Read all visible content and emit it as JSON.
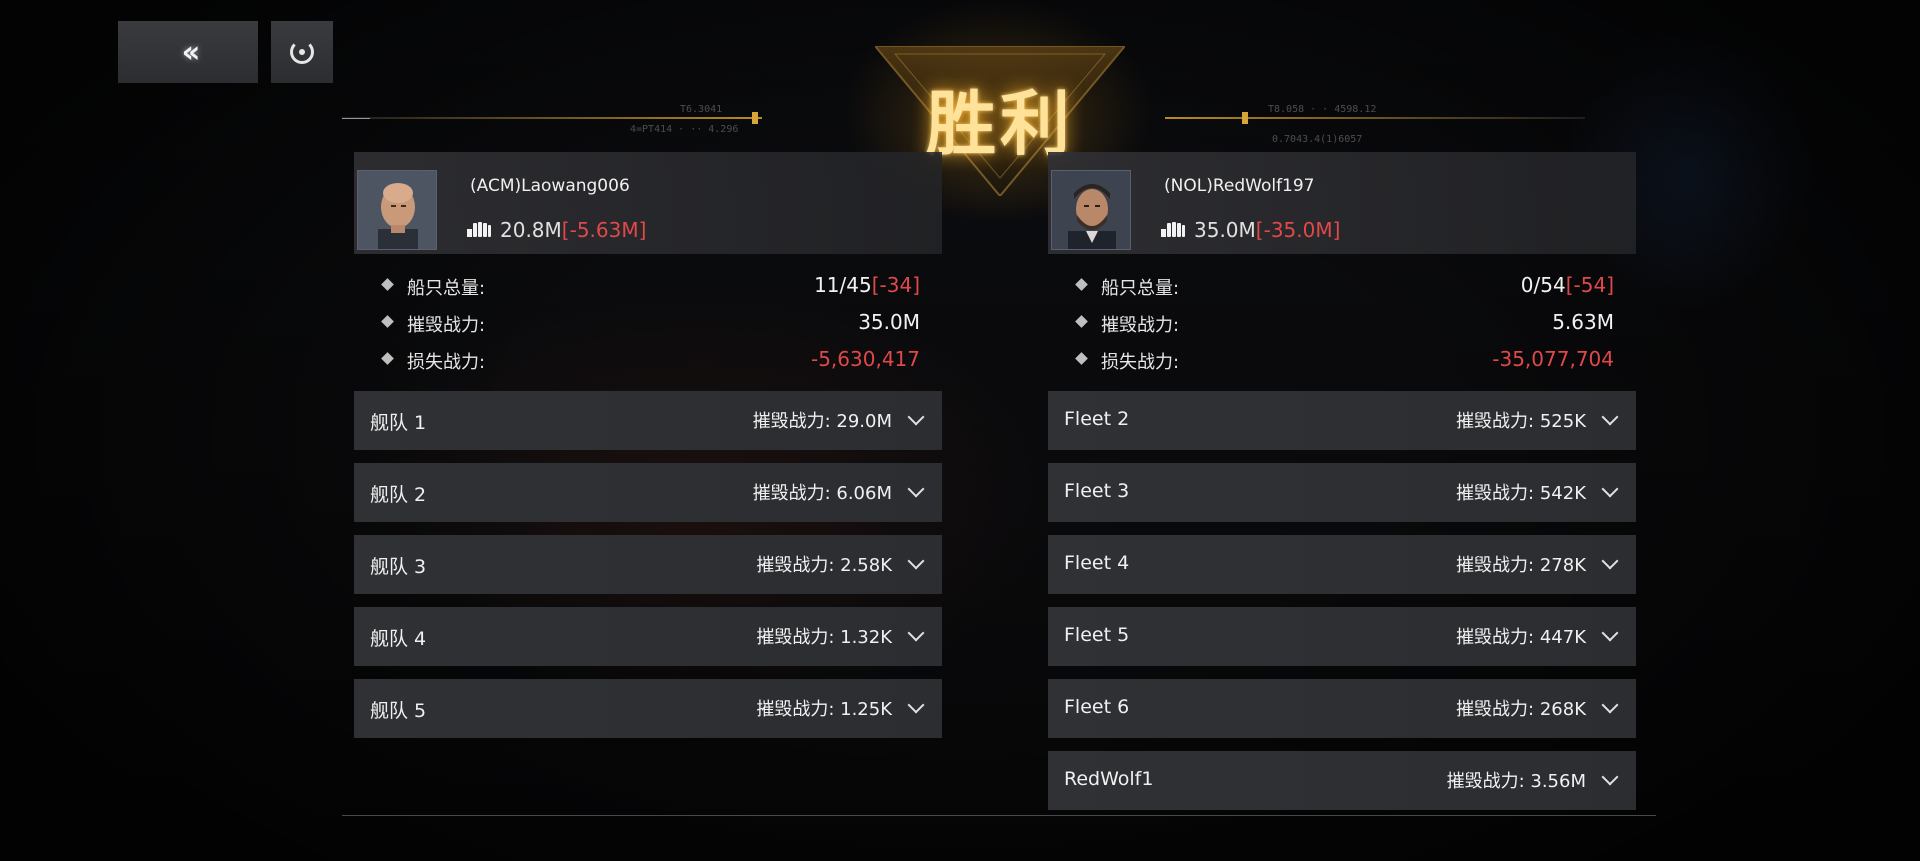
{
  "nav": {
    "back_icon": "double-chevron-left-icon",
    "replay_icon": "replay-icon"
  },
  "header": {
    "title": "胜利",
    "title_color": "#ffe29a",
    "deco_left_1": "T6.3041",
    "deco_left_2": "4=PT414 · ·· 4.296",
    "deco_right_1": "T8.058 · · 4598.12",
    "deco_right_2": "0.7043.4(1)6057"
  },
  "colors": {
    "negative": "#e0484a",
    "accent_gold": "#d8a53a"
  },
  "left": {
    "name": "(ACM)Laowang006",
    "power": "20.8M",
    "power_diff": "[-5.63M]",
    "stats": {
      "ships_label": "船只总量:",
      "ships_value": "11/45",
      "ships_diff": "[-34]",
      "destroyed_label": "摧毁战力:",
      "destroyed_value": "35.0M",
      "lost_label": "损失战力:",
      "lost_value": "-5,630,417"
    },
    "fleets": [
      {
        "name": "舰队 1",
        "stat": "摧毁战力: 29.0M"
      },
      {
        "name": "舰队 2",
        "stat": "摧毁战力: 6.06M"
      },
      {
        "name": "舰队 3",
        "stat": "摧毁战力: 2.58K"
      },
      {
        "name": "舰队 4",
        "stat": "摧毁战力: 1.32K"
      },
      {
        "name": "舰队 5",
        "stat": "摧毁战力: 1.25K"
      }
    ]
  },
  "right": {
    "name": "(NOL)RedWolf197",
    "power": "35.0M",
    "power_diff": "[-35.0M]",
    "stats": {
      "ships_label": "船只总量:",
      "ships_value": "0/54",
      "ships_diff": "[-54]",
      "destroyed_label": "摧毁战力:",
      "destroyed_value": "5.63M",
      "lost_label": "损失战力:",
      "lost_value": "-35,077,704"
    },
    "fleets": [
      {
        "name": "Fleet 2",
        "stat": "摧毁战力: 525K"
      },
      {
        "name": "Fleet 3",
        "stat": "摧毁战力: 542K"
      },
      {
        "name": "Fleet 4",
        "stat": "摧毁战力: 278K"
      },
      {
        "name": "Fleet 5",
        "stat": "摧毁战力: 447K"
      },
      {
        "name": "Fleet 6",
        "stat": "摧毁战力: 268K"
      },
      {
        "name": "RedWolf1",
        "stat": "摧毁战力: 3.56M"
      }
    ]
  }
}
